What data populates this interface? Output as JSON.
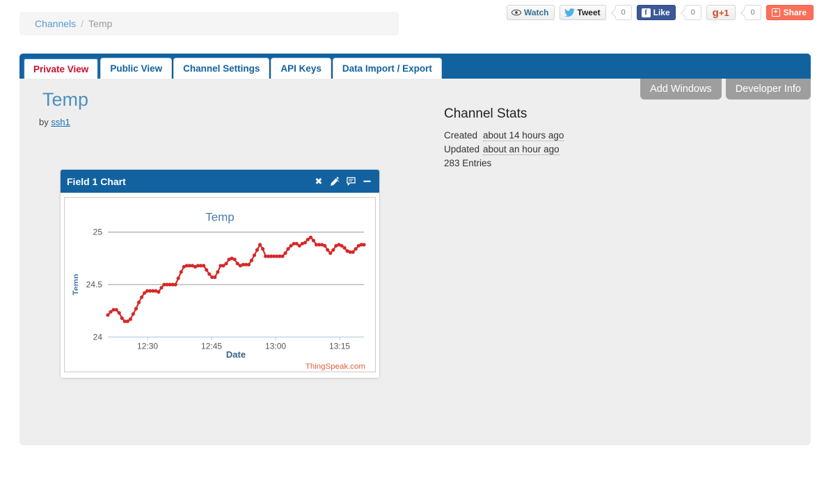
{
  "social": {
    "watch": {
      "label": "Watch",
      "icon": "eye-icon"
    },
    "tweet": {
      "label": "Tweet",
      "count": "0",
      "icon": "twitter-bird-icon"
    },
    "like": {
      "label": "Like",
      "count": "0",
      "icon": "facebook-f-icon",
      "color": "#3b5998"
    },
    "gplus": {
      "label": "+1",
      "glyph": "g",
      "count": "0",
      "color": "#d9452c"
    },
    "share": {
      "label": "Share",
      "icon": "plus-box-icon",
      "color": "#f9705a"
    }
  },
  "breadcrumb": {
    "root": "Channels",
    "separator": "/",
    "current": "Temp"
  },
  "tabs": [
    {
      "label": "Private View",
      "active": true
    },
    {
      "label": "Public View",
      "active": false
    },
    {
      "label": "Channel Settings",
      "active": false
    },
    {
      "label": "API Keys",
      "active": false
    },
    {
      "label": "Data Import / Export",
      "active": false
    }
  ],
  "toolbar": {
    "add_windows": "Add Windows",
    "developer_info": "Developer Info"
  },
  "channel": {
    "title": "Temp",
    "by_prefix": "by",
    "author": "ssh1"
  },
  "stats": {
    "heading": "Channel Stats",
    "created_label": "Created",
    "created_value": "about 14 hours ago",
    "updated_label": "Updated",
    "updated_value": "about an hour ago",
    "entries": "283 Entries"
  },
  "widget": {
    "title": "Field 1 Chart",
    "icons": {
      "close": "✖",
      "edit": "✎",
      "annotate": "⌲",
      "minimize": "—"
    }
  },
  "chart_data": {
    "type": "line",
    "title": "Temp",
    "xlabel": "Date",
    "ylabel": "Temp",
    "watermark": "ThingSpeak.com",
    "line_color": "#d62728",
    "grid": true,
    "ylim": [
      24,
      25
    ],
    "yticks": [
      24,
      24.5,
      25
    ],
    "ytick_labels": [
      "24",
      "24.5",
      "25"
    ],
    "xticks": [
      "12:30",
      "12:45",
      "13:00",
      "13:15"
    ],
    "xtick_positions": [
      0.155,
      0.405,
      0.655,
      0.905
    ],
    "xlim_labels": [
      "12:22",
      "13:22"
    ],
    "x": [
      0.0,
      0.011,
      0.022,
      0.033,
      0.044,
      0.055,
      0.066,
      0.077,
      0.088,
      0.099,
      0.11,
      0.121,
      0.132,
      0.143,
      0.154,
      0.165,
      0.176,
      0.187,
      0.198,
      0.209,
      0.22,
      0.231,
      0.242,
      0.253,
      0.264,
      0.275,
      0.286,
      0.297,
      0.308,
      0.319,
      0.33,
      0.341,
      0.352,
      0.363,
      0.374,
      0.385,
      0.396,
      0.407,
      0.418,
      0.429,
      0.44,
      0.451,
      0.462,
      0.473,
      0.484,
      0.495,
      0.506,
      0.517,
      0.528,
      0.539,
      0.55,
      0.561,
      0.572,
      0.583,
      0.594,
      0.605,
      0.616,
      0.627,
      0.638,
      0.649,
      0.66,
      0.671,
      0.682,
      0.693,
      0.704,
      0.715,
      0.726,
      0.737,
      0.748,
      0.759,
      0.77,
      0.781,
      0.792,
      0.803,
      0.814,
      0.825,
      0.836,
      0.847,
      0.858,
      0.869,
      0.88,
      0.891,
      0.902,
      0.913,
      0.924,
      0.935,
      0.946,
      0.957,
      0.968,
      0.979,
      0.99,
      1.0
    ],
    "values": [
      24.21,
      24.24,
      24.26,
      24.26,
      24.23,
      24.18,
      24.15,
      24.15,
      24.17,
      24.22,
      24.27,
      24.33,
      24.38,
      24.42,
      24.44,
      24.44,
      24.44,
      24.44,
      24.43,
      24.47,
      24.5,
      24.5,
      24.5,
      24.5,
      24.5,
      24.56,
      24.62,
      24.67,
      24.68,
      24.68,
      24.68,
      24.67,
      24.68,
      24.68,
      24.68,
      24.64,
      24.6,
      24.57,
      24.57,
      24.62,
      24.68,
      24.68,
      24.7,
      24.74,
      24.75,
      24.74,
      24.7,
      24.68,
      24.69,
      24.69,
      24.69,
      24.73,
      24.78,
      24.83,
      24.88,
      24.84,
      24.77,
      24.77,
      24.77,
      24.77,
      24.77,
      24.77,
      24.77,
      24.8,
      24.84,
      24.87,
      24.89,
      24.89,
      24.87,
      24.89,
      24.9,
      24.93,
      24.95,
      24.92,
      24.88,
      24.88,
      24.88,
      24.87,
      24.83,
      24.8,
      24.83,
      24.87,
      24.88,
      24.87,
      24.85,
      24.82,
      24.81,
      24.81,
      24.84,
      24.87,
      24.88,
      24.88
    ]
  }
}
